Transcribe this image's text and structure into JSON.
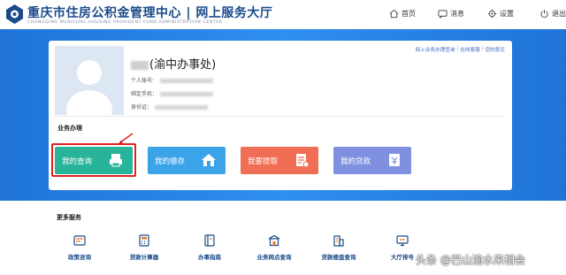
{
  "header": {
    "title": "重庆市住房公积金管理中心 | 网上服务大厅",
    "subtitle": "CHONGQING MUNICIPAL HOUSING PROVIDENT FUND ADMINISTRATION CENTER",
    "nav": [
      {
        "label": "首页",
        "icon": "home-icon"
      },
      {
        "label": "消息",
        "icon": "message-icon"
      },
      {
        "label": "设置",
        "icon": "gear-icon"
      },
      {
        "label": "退出",
        "icon": "logout-icon"
      }
    ]
  },
  "user": {
    "name_suffix": "(渝中办事处)",
    "fields": [
      {
        "label": "个人账号："
      },
      {
        "label": "绑定手机："
      },
      {
        "label": "身份证："
      }
    ]
  },
  "quick_links": [
    "网上业务办理查询",
    "在线客服",
    "您的意见"
  ],
  "business": {
    "title": "业务办理",
    "tiles": [
      {
        "label": "我的查询",
        "icon": "printer-icon",
        "color": "#27b49a"
      },
      {
        "label": "我的缴存",
        "icon": "house-icon",
        "color": "#3ba3e8"
      },
      {
        "label": "我要提取",
        "icon": "document-icon",
        "color": "#f06e54"
      },
      {
        "label": "我的贷款",
        "icon": "loan-icon",
        "color": "#7f90e0"
      }
    ]
  },
  "more_services": {
    "title": "更多服务",
    "items": [
      {
        "label": "政策咨询"
      },
      {
        "label": "贷款计算器"
      },
      {
        "label": "办事指南"
      },
      {
        "label": "业务网点查询"
      },
      {
        "label": "贷款楼盘查询"
      },
      {
        "label": "大厅排号"
      }
    ]
  },
  "watermark": "头条 @巴山渝水来相会",
  "colors": {
    "brand": "#1a4a8a",
    "hero": "#2f8ff0",
    "highlight": "#e22020"
  }
}
